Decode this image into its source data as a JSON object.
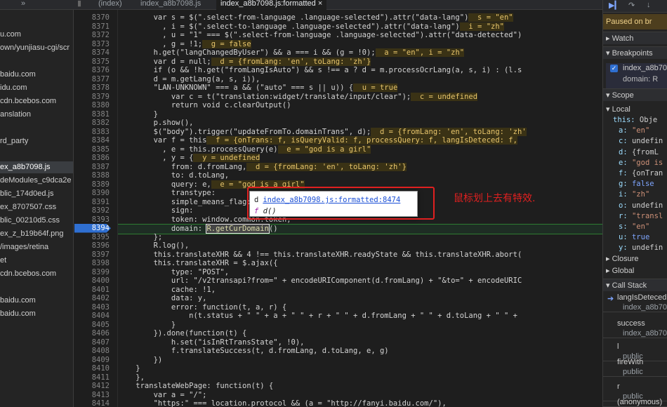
{
  "tabs": {
    "nav_glyph": "»",
    "index": "(index)",
    "file1": "index_a8b7098.js",
    "active": "index_a8b7098.js:formatted",
    "close": "×"
  },
  "nav_items": [
    "u.com",
    "own/yunjiasu-cgi/scr",
    "",
    "baidu.com",
    "idu.com",
    "cdn.bcebos.com",
    "anslation",
    "",
    "rd_party",
    "",
    "ex_a8b7098.js",
    "deModules_c9dca2e",
    "blic_174d0ed.js",
    "ex_8707507.css",
    "blic_00210d5.css",
    "ex_z_b19b64f.png",
    "/images/retina",
    "et",
    "cdn.bcebos.com",
    "baidu.com",
    "baidu.com"
  ],
  "line_numbers": [
    "8370",
    "8371",
    "8372",
    "8373",
    "8374",
    "8375",
    "8376",
    "8377",
    "8378",
    "8379",
    "8380",
    "8381",
    "8382",
    "8383",
    "8384",
    "8385",
    "8386",
    "8387",
    "8388",
    "8389",
    "8390",
    "8391",
    "8392",
    "8393",
    "8394",
    "8395",
    "8396",
    "8397",
    "8398",
    "8399",
    "8400",
    "8401",
    "8402",
    "8403",
    "8404",
    "8405",
    "8406",
    "8407",
    "8408",
    "8409",
    "8410",
    "8411",
    "8412",
    "8413",
    "8414"
  ],
  "code": {
    "l8370": "        var s = $(\".select-from-language .language-selected\").attr(\"data-lang\")",
    "l8370i": "  s = \"en\"",
    "l8371": "          , i = $(\".select-to-language .language-selected\").attr(\"data-lang\")",
    "l8371i": "  i = \"zh\"",
    "l8372": "          , u = \"1\" === $(\".select-from-language .language-selected\").attr(\"data-detected\")",
    "l8373": "          , g = !1;",
    "l8373i": "  g = false",
    "l8374": "        h.get(\"langChangedByUser\") && a === i && (g = !0);",
    "l8374i": "  a = \"en\", i = \"zh\"",
    "l8375": "        var d = null;",
    "l8375i": "  d = {fromLang: 'en', toLang: 'zh'}",
    "l8376": "        if (o && !h.get(\"fromLangIsAuto\") && s !== a ? d = m.processOcrLang(a, s, i) : (l.s",
    "l8377": "        d = m.getLang(a, s, i)),",
    "l8378": "        \"LAN-UNKNOWN\" === a && (\"auto\" === s || u)) {",
    "l8378i": "  u = true",
    "l8379": "            var c = t(\"translation:widget/translate/input/clear\");",
    "l8379i": "  c = undefined",
    "l8380": "            return void c.clearOutput()",
    "l8381": "        }",
    "l8382": "        p.show(),",
    "l8383": "        $(\"body\").trigger(\"updateFromTo.domainTrans\", d);",
    "l8383i": "  d = {fromLang: 'en', toLang: 'zh'",
    "l8384": "        var f = this",
    "l8384i": "  f = {onTrans: f, isQueryValid: f, processQuery: f, langIsDeteced: f,",
    "l8385": "          , e = this.processQuery(e)",
    "l8385i": "  e = \"god is a girl\"",
    "l8386": "          , y = {",
    "l8386i": "  y = undefined",
    "l8387": "            from: d.fromLang,",
    "l8387i": "  d = {fromLang: 'en', toLang: 'zh'}",
    "l8388": "            to: d.toLang,",
    "l8389": "            query: e,",
    "l8389i": "  e = \"god is a girl\"",
    "l8390": "            transtype: ",
    "l8391": "            simple_means_flag: 3,",
    "l8392": "            sign: ",
    "l8393": "            token: window.common.token,",
    "l8394a": "            domain: ",
    "l8394b": "R.getCurDomain",
    "l8394c": "()",
    "l8395": "        };",
    "l8396": "        R.log(),",
    "l8397": "        this.translateXHR && 4 !== this.translateXHR.readyState && this.translateXHR.abort(",
    "l8398": "        this.translateXHR = $.ajax({",
    "l8399": "            type: \"POST\",",
    "l8400": "            url: \"/v2transapi?from=\" + encodeURIComponent(d.fromLang) + \"&to=\" + encodeURIC",
    "l8401": "            cache: !1,",
    "l8402": "            data: y,",
    "l8403": "            error: function(t, a, r) {",
    "l8404": "                n(t.status + \" \" + a + \" \" + r + \" \" + d.fromLang + \" \" + d.toLang + \" \" +",
    "l8405": "            }",
    "l8406": "        }).done(function(t) {",
    "l8407": "            h.set(\"isInRtTransState\", !0),",
    "l8408": "            f.translateSuccess(t, d.fromLang, d.toLang, e, g)",
    "l8409": "        })",
    "l8410": "    }",
    "l8411": "    },",
    "l8412": "    translateWebPage: function(t) {",
    "l8413": "        var a = \"/\";",
    "l8414": "        \"https:\" === location.protocol && (a = \"http://fanyi.baidu.com/\"),"
  },
  "popup": {
    "label": "d",
    "link": "index_a8b7098.js:formatted:8474",
    "f": "f",
    "sig": "d()"
  },
  "annotation": "鼠标划上去有特效.",
  "right": {
    "paused": "Paused on br",
    "watch": "Watch",
    "breakpoints": "Breakpoints",
    "bp_file": "index_a8b70",
    "bp_code": "domain: R",
    "scope": "Scope",
    "local": "Local",
    "scope_rows": [
      {
        "k": "this:",
        "v": " Obje"
      },
      {
        "k": "a:",
        "v": " \"en\""
      },
      {
        "k": "c:",
        "v": " undefin"
      },
      {
        "k": "d:",
        "v": " {fromL"
      },
      {
        "k": "e:",
        "v": " \"god is"
      },
      {
        "k": "f:",
        "v": " {onTran"
      },
      {
        "k": "g:",
        "v": " false"
      },
      {
        "k": "i:",
        "v": " \"zh\""
      },
      {
        "k": "o:",
        "v": " undefin"
      },
      {
        "k": "r:",
        "v": " \"transl"
      },
      {
        "k": "s:",
        "v": " \"en\""
      },
      {
        "k": "u:",
        "v": " true"
      },
      {
        "k": "y:",
        "v": " undefin"
      }
    ],
    "closure": "Closure",
    "global": "Global",
    "callstack": "Call Stack",
    "frames": [
      {
        "fn": "langIsDeteced",
        "file": "index_a8b70"
      },
      {
        "fn": "success",
        "file": "index_a8b70"
      },
      {
        "fn": "l",
        "file": "public"
      },
      {
        "fn": "fireWith",
        "file": "public"
      },
      {
        "fn": "r",
        "file": "public"
      },
      {
        "fn": "(anonymous)",
        "file": ""
      }
    ]
  },
  "colors": {
    "breakpoint": "#2f6fd1",
    "annotation": "#e02020",
    "paused_bg": "#4d3e1e"
  }
}
